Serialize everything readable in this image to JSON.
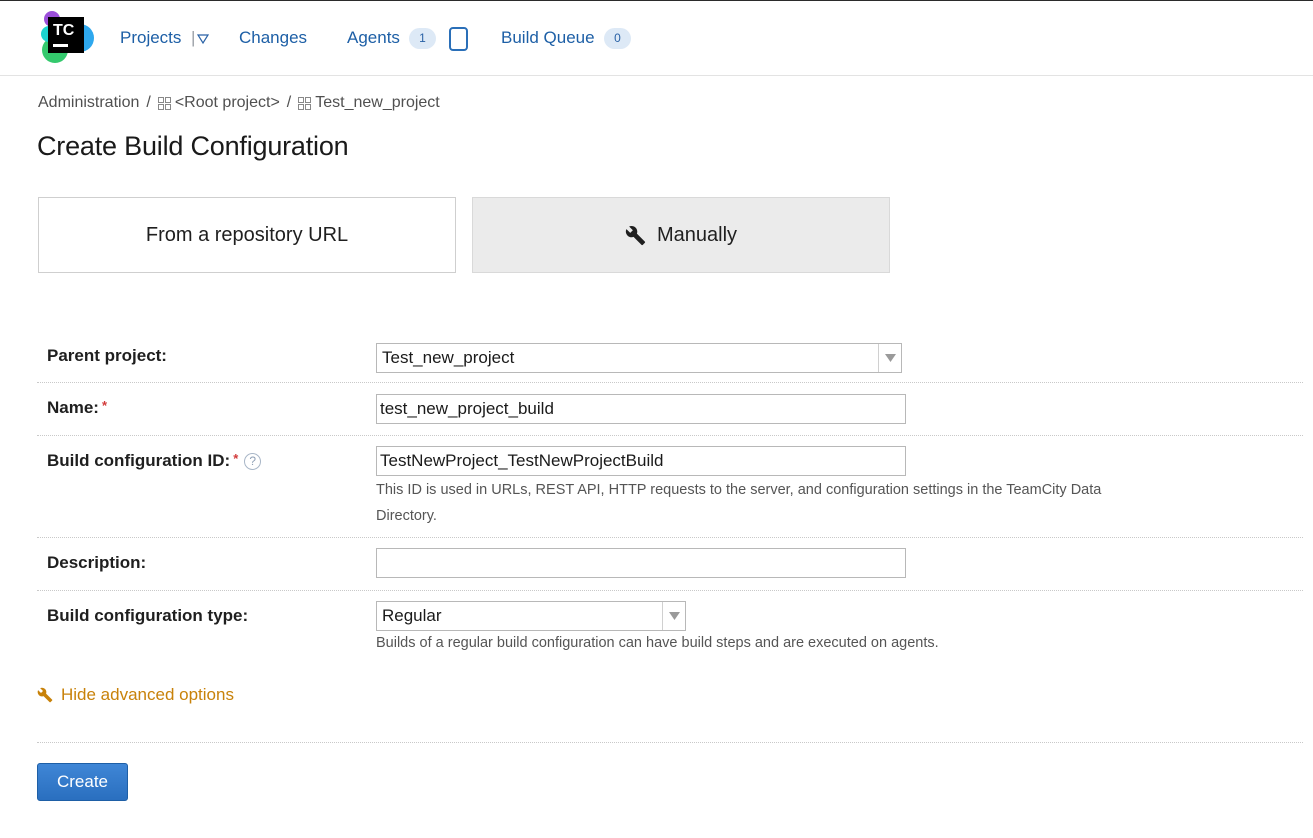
{
  "header": {
    "logo_text": "TC",
    "nav": {
      "projects": "Projects",
      "projects_sep": "|",
      "changes": "Changes",
      "agents": "Agents",
      "agents_count": "1",
      "build_queue": "Build Queue",
      "build_queue_count": "0"
    }
  },
  "breadcrumb": {
    "admin": "Administration",
    "sep": "/",
    "root": "<Root project>",
    "current": "Test_new_project"
  },
  "page": {
    "title": "Create Build Configuration"
  },
  "modes": {
    "repo": "From a repository URL",
    "manual": "Manually",
    "selected": "Manually"
  },
  "form": {
    "required_mark": "*",
    "help_glyph": "?",
    "parent_project": {
      "label": "Parent project:",
      "value": "Test_new_project"
    },
    "name": {
      "label": "Name:",
      "value": "test_new_project_build"
    },
    "config_id": {
      "label": "Build configuration ID:",
      "value": "TestNewProject_TestNewProjectBuild",
      "hint_line1": "This ID is used in URLs, REST API, HTTP requests to the server, and configuration settings in the TeamCity Data",
      "hint_line2": "Directory."
    },
    "description": {
      "label": "Description:",
      "value": ""
    },
    "config_type": {
      "label": "Build configuration type:",
      "value": "Regular",
      "hint": "Builds of a regular build configuration can have build steps and are executed on agents."
    }
  },
  "advanced": {
    "toggle_label": "Hide advanced options"
  },
  "actions": {
    "create_label": "Create"
  },
  "colors": {
    "link": "#1d5fa6",
    "badge_bg": "#dde9f6",
    "advanced_link": "#c8820a",
    "primary_button": "#2a6fbf",
    "required": "#d23a3a"
  },
  "icons": {
    "logo": "teamcity-logo",
    "projects_dropdown": "triangle-down-icon",
    "agent": "agent-device-icon",
    "project": "project-grid-icon",
    "manual": "wrench-icon",
    "help": "help-icon",
    "advanced": "wrench-icon"
  }
}
